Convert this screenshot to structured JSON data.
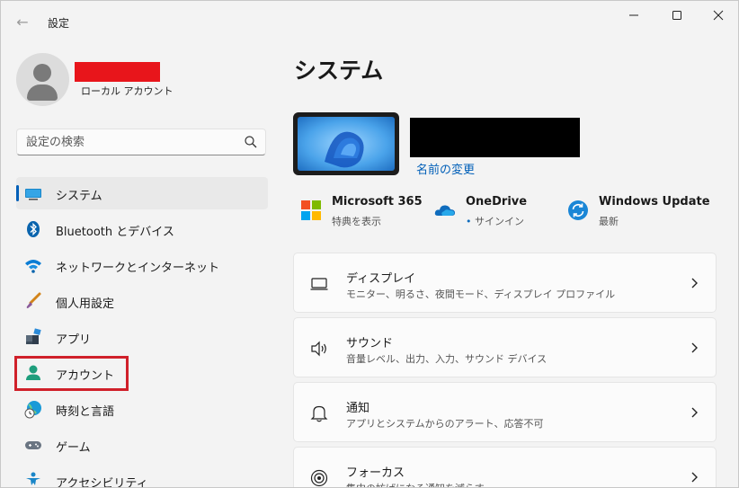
{
  "window": {
    "title": "設定",
    "back": "←",
    "minimize": "—",
    "maximize": "☐",
    "close": "✕"
  },
  "profile": {
    "account_type": "ローカル アカウント"
  },
  "search": {
    "placeholder": "設定の検索"
  },
  "nav": {
    "items": [
      {
        "label": "システム",
        "icon": "monitor-icon",
        "active": true
      },
      {
        "label": "Bluetooth とデバイス",
        "icon": "bluetooth-icon"
      },
      {
        "label": "ネットワークとインターネット",
        "icon": "wifi-icon"
      },
      {
        "label": "個人用設定",
        "icon": "brush-icon"
      },
      {
        "label": "アプリ",
        "icon": "apps-icon"
      },
      {
        "label": "アカウント",
        "icon": "person-icon",
        "highlighted": true
      },
      {
        "label": "時刻と言語",
        "icon": "globe-clock-icon"
      },
      {
        "label": "ゲーム",
        "icon": "gamepad-icon"
      },
      {
        "label": "アクセシビリティ",
        "icon": "accessibility-icon"
      }
    ]
  },
  "main": {
    "title": "システム",
    "rename_link": "名前の変更",
    "quick_links": [
      {
        "title": "Microsoft 365",
        "subtitle": "特典を表示",
        "icon": "microsoft-365-icon"
      },
      {
        "title": "OneDrive",
        "subtitle": "サインイン",
        "icon": "onedrive-icon"
      },
      {
        "title": "Windows Update",
        "subtitle": "最新",
        "icon": "windows-update-icon"
      }
    ],
    "cards": [
      {
        "title": "ディスプレイ",
        "subtitle": "モニター、明るさ、夜間モード、ディスプレイ プロファイル",
        "icon": "display-icon"
      },
      {
        "title": "サウンド",
        "subtitle": "音量レベル、出力、入力、サウンド デバイス",
        "icon": "speaker-icon"
      },
      {
        "title": "通知",
        "subtitle": "アプリとシステムからのアラート、応答不可",
        "icon": "bell-icon"
      },
      {
        "title": "フォーカス",
        "subtitle": "集中の妨げになる通知を減らす",
        "icon": "focus-icon"
      }
    ]
  },
  "colors": {
    "accent": "#005fb8",
    "highlight_box": "#d0202a",
    "redaction_red": "#e8151b",
    "redaction_black": "#000000",
    "background": "#f3f3f3"
  }
}
